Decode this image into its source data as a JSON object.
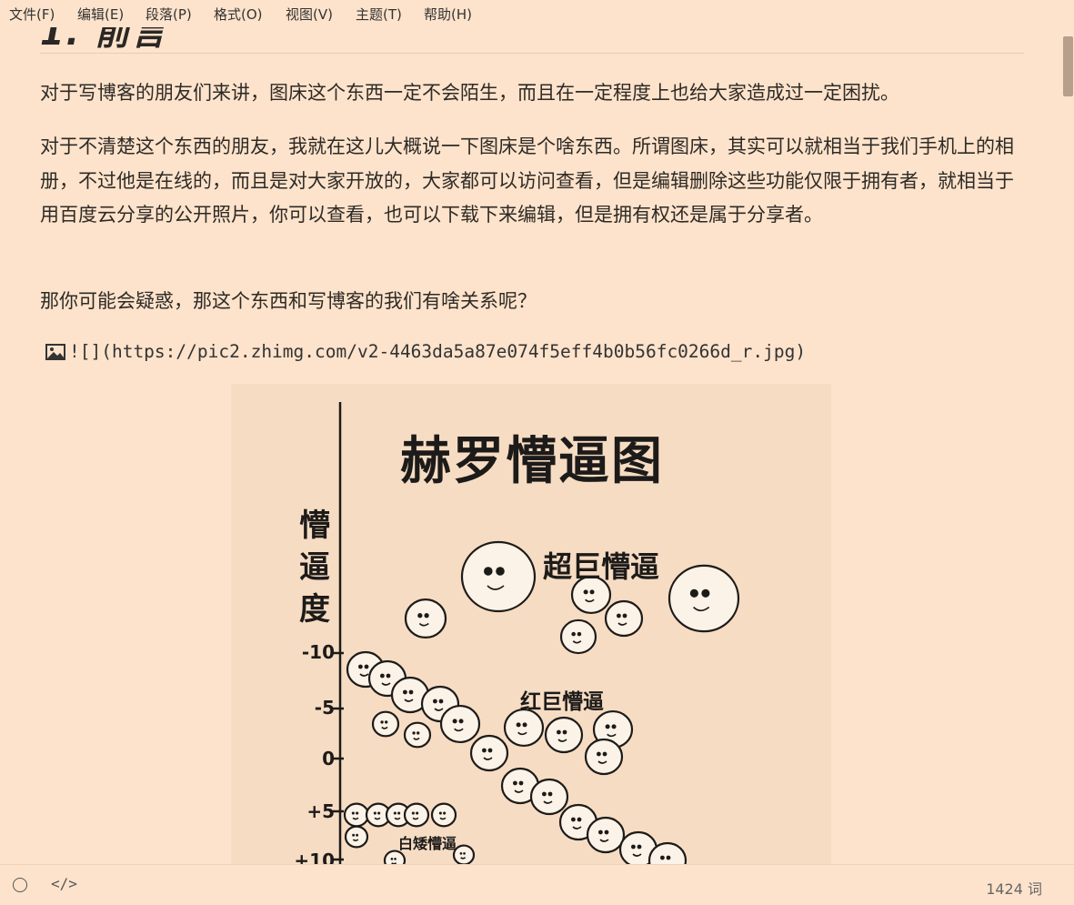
{
  "menu": [
    "文件(F)",
    "编辑(E)",
    "段落(P)",
    "格式(O)",
    "视图(V)",
    "主题(T)",
    "帮助(H)"
  ],
  "document": {
    "heading": "1. 前言",
    "paragraphs": [
      "对于写博客的朋友们来讲，图床这个东西一定不会陌生，而且在一定程度上也给大家造成过一定困扰。",
      "对于不清楚这个东西的朋友，我就在这儿大概说一下图床是个啥东西。所谓图床，其实可以就相当于我们手机上的相册，不过他是在线的，而且是对大家开放的，大家都可以访问查看，但是编辑删除这些功能仅限于拥有者，就相当于用百度云分享的公开照片，你可以查看，也可以下载下来编辑，但是拥有权还是属于分享者。",
      "那你可能会疑惑，那这个东西和写博客的我们有啥关系呢？"
    ],
    "image_markdown": "![](https://pic2.zhimg.com/v2-4463da5a87e074f5eff4b0b56fc0266d_r.jpg)"
  },
  "image_content": {
    "title": "赫罗懵逼图",
    "y_label": "懵逼度",
    "ticks": [
      "-10",
      "-5",
      "0",
      "+5",
      "+10"
    ],
    "labels": {
      "super": "超巨懵逼",
      "red": "红巨懵逼",
      "white": "白矮懵逼"
    }
  },
  "status": {
    "word_count": "1424 词"
  }
}
